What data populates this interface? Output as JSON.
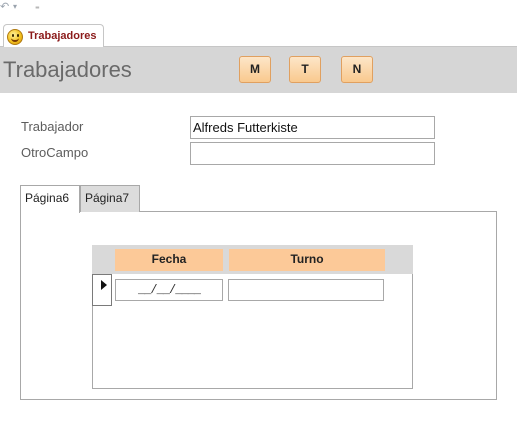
{
  "qat": {
    "undo_glyph": "↶",
    "dropdown_glyph": "▾",
    "customize_glyph": "₌"
  },
  "document_tab": {
    "label": "Trabajadores",
    "icon": "smiley-icon"
  },
  "header": {
    "title": "Trabajadores",
    "buttons": {
      "m": "M",
      "t": "T",
      "n": "N"
    }
  },
  "form": {
    "trabajador_label": "Trabajador",
    "trabajador_value": "Alfreds Futterkiste",
    "otrocampo_label": "OtroCampo",
    "otrocampo_value": ""
  },
  "tabs": [
    {
      "label": "Página6",
      "active": true
    },
    {
      "label": "Página7",
      "active": false
    }
  ],
  "subform": {
    "columns": [
      "Fecha",
      "Turno"
    ],
    "new_row": {
      "fecha_mask": "__/__/____",
      "turno": ""
    }
  },
  "colors": {
    "header_bg": "#d6d6d6",
    "button_fill": "#f9c98e",
    "column_header_fill": "#fcc998",
    "tab_label": "#8b1a1a"
  }
}
